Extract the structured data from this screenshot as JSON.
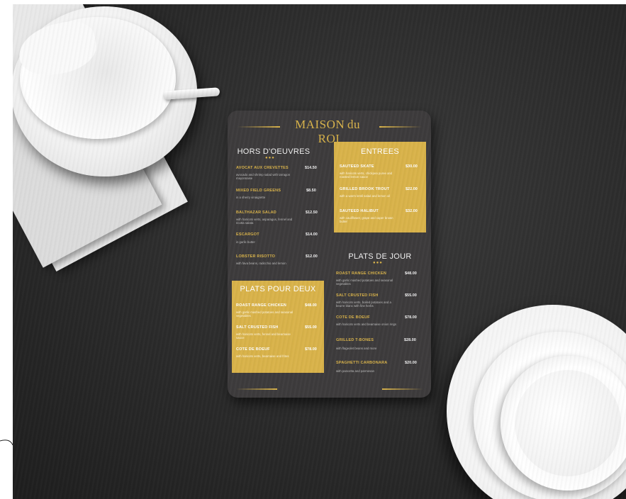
{
  "menu": {
    "logo": "MAISON du ROI",
    "hors": {
      "title": "HORS D'OEUVRES",
      "items": [
        {
          "name": "AVOCAT AUX CREVETTES",
          "price": "$14.50",
          "desc": "avocado and shrimp salad with tarragon mayonnaise"
        },
        {
          "name": "MIXED FIELD GREENS",
          "price": "$8.50",
          "desc": "in a sherry vinaigrette"
        },
        {
          "name": "BALTHAZAR SALAD",
          "price": "$12.50",
          "desc": "with haricots verts, asparagus, fennel and ricotta salata"
        },
        {
          "name": "ESCARGOT",
          "price": "$14.00",
          "desc": "in garlic butter"
        },
        {
          "name": "LOBSTER RISOTTO",
          "price": "$12.00",
          "desc": "with fava beans, radicchio and lemon"
        }
      ]
    },
    "entrees": {
      "title": "ENTREES",
      "items": [
        {
          "name": "SAUTEED SKATE",
          "price": "$30.00",
          "desc": "with haricots verts, chickpea puree and roasted lemon sauce"
        },
        {
          "name": "GRILLED BROOK TROUT",
          "price": "$22.00",
          "desc": "with a warm lentil salad and lemon oil"
        },
        {
          "name": "SAUTEED HALIBUT",
          "price": "$32.00",
          "desc": "with cauliflower, grape and caper brown butter"
        }
      ]
    },
    "deux": {
      "title": "PLATS POUR DEUX",
      "items": [
        {
          "name": "ROAST RANGE CHICKEN",
          "price": "$48.00",
          "desc": "with garlic mashed potatoes and seasonal vegetables"
        },
        {
          "name": "SALT CRUSTED FISH",
          "price": "$55.00",
          "desc": "with haricots verts, fennel and bearnaise sauce"
        },
        {
          "name": "COTE DE BOEUF",
          "price": "$78.00",
          "desc": "with haricots verts, bearnaise and frites"
        }
      ]
    },
    "jour": {
      "title": "PLATS DE JOUR",
      "items": [
        {
          "name": "ROAST RANGE CHICKEN",
          "price": "$48.00",
          "desc": "with garlic mashed potatoes and seasonal vegetables"
        },
        {
          "name": "SALT CRUSTED FISH",
          "price": "$55.00",
          "desc": "with haricots verts, boiled potatoes and a beurre blanc with fine herbs"
        },
        {
          "name": "COTE DE BOEUF",
          "price": "$78.00",
          "desc": "with haricots verts and bearnaise onion rings"
        },
        {
          "name": "GRILLED T-BONES",
          "price": "$28.00",
          "desc": "with flageolet beans and more"
        },
        {
          "name": "SPAGHETTI CARBONARA",
          "price": "$20.00",
          "desc": "with pancetta and parmesan"
        }
      ]
    },
    "dots": "●●●"
  }
}
